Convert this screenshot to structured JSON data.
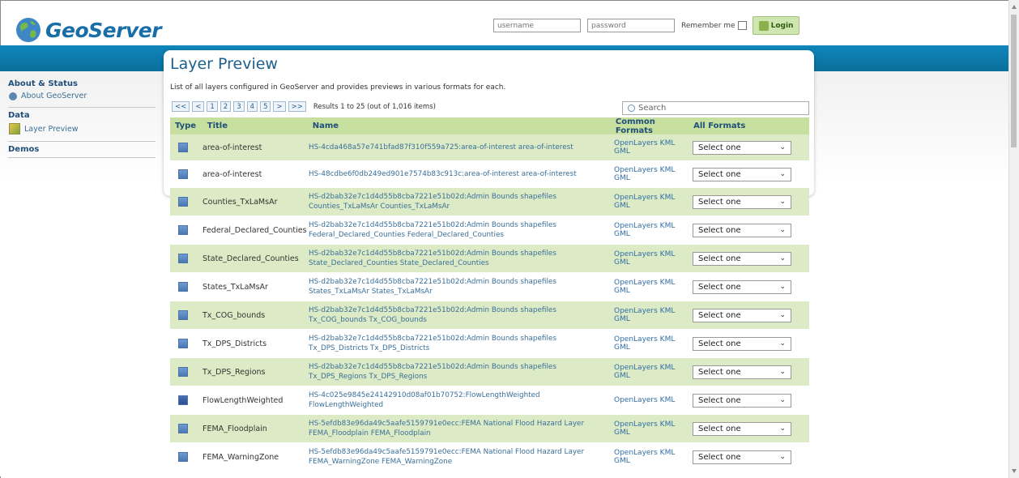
{
  "header": {
    "logo_text": "GeoServer",
    "username_placeholder": "username",
    "password_placeholder": "password",
    "remember_label": "Remember me",
    "login_label": "Login"
  },
  "sidebar": {
    "sections": [
      {
        "title": "About & Status",
        "items": [
          {
            "label": "About GeoServer",
            "icon": "info-icon"
          }
        ]
      },
      {
        "title": "Data",
        "items": [
          {
            "label": "Layer Preview",
            "icon": "layer-preview-icon"
          }
        ]
      },
      {
        "title": "Demos",
        "items": []
      }
    ]
  },
  "main": {
    "title": "Layer Preview",
    "description": "List of all layers configured in GeoServer and provides previews in various formats for each.",
    "pager": {
      "buttons": [
        "<<",
        "<",
        "1",
        "2",
        "3",
        "4",
        "5",
        ">",
        ">>"
      ],
      "results_text": "Results 1 to 25 (out of 1,016 items)"
    },
    "search_placeholder": "Search",
    "columns": {
      "type": "Type",
      "title": "Title",
      "name": "Name",
      "common": "Common Formats",
      "all": "All Formats"
    },
    "rows": [
      {
        "title": "area-of-interest",
        "name1": "HS-4cda468a57e741bfad87f310f559a725:area-of-interest area-of-interest",
        "name2": "",
        "common": "OpenLayers KML GML",
        "select": "Select one",
        "type": "polygon"
      },
      {
        "title": "area-of-interest",
        "name1": "HS-48cdbe6f0db249ed901e7574b83c913c:area-of-interest area-of-interest",
        "name2": "",
        "common": "OpenLayers KML GML",
        "select": "Select one",
        "type": "polygon"
      },
      {
        "title": "Counties_TxLaMsAr",
        "name1": "HS-d2bab32e7c1d4d55b8cba7221e51b02d:Admin Bounds shapefiles",
        "name2": "Counties_TxLaMsAr Counties_TxLaMsAr",
        "common": "OpenLayers KML GML",
        "select": "Select one",
        "type": "polygon"
      },
      {
        "title": "Federal_Declared_Counties",
        "name1": "HS-d2bab32e7c1d4d55b8cba7221e51b02d:Admin Bounds shapefiles",
        "name2": "Federal_Declared_Counties Federal_Declared_Counties",
        "common": "OpenLayers KML GML",
        "select": "Select one",
        "type": "polygon"
      },
      {
        "title": "State_Declared_Counties",
        "name1": "HS-d2bab32e7c1d4d55b8cba7221e51b02d:Admin Bounds shapefiles",
        "name2": "State_Declared_Counties State_Declared_Counties",
        "common": "OpenLayers KML GML",
        "select": "Select one",
        "type": "polygon"
      },
      {
        "title": "States_TxLaMsAr",
        "name1": "HS-d2bab32e7c1d4d55b8cba7221e51b02d:Admin Bounds shapefiles",
        "name2": "States_TxLaMsAr States_TxLaMsAr",
        "common": "OpenLayers KML GML",
        "select": "Select one",
        "type": "polygon"
      },
      {
        "title": "Tx_COG_bounds",
        "name1": "HS-d2bab32e7c1d4d55b8cba7221e51b02d:Admin Bounds shapefiles",
        "name2": "Tx_COG_bounds Tx_COG_bounds",
        "common": "OpenLayers KML GML",
        "select": "Select one",
        "type": "polygon"
      },
      {
        "title": "Tx_DPS_Districts",
        "name1": "HS-d2bab32e7c1d4d55b8cba7221e51b02d:Admin Bounds shapefiles",
        "name2": "Tx_DPS_Districts Tx_DPS_Districts",
        "common": "OpenLayers KML GML",
        "select": "Select one",
        "type": "polygon"
      },
      {
        "title": "Tx_DPS_Regions",
        "name1": "HS-d2bab32e7c1d4d55b8cba7221e51b02d:Admin Bounds shapefiles",
        "name2": "Tx_DPS_Regions Tx_DPS_Regions",
        "common": "OpenLayers KML GML",
        "select": "Select one",
        "type": "polygon"
      },
      {
        "title": "FlowLengthWeighted",
        "name1": "HS-4c025e9845e24142910d08af01b70752:FlowLengthWeighted",
        "name2": "FlowLengthWeighted",
        "common": "OpenLayers KML",
        "select": "Select one",
        "type": "raster"
      },
      {
        "title": "FEMA_Floodplain",
        "name1": "HS-5efdb83e96da49c5aafe5159791e0ecc:FEMA National Flood Hazard Layer",
        "name2": "FEMA_Floodplain FEMA_Floodplain",
        "common": "OpenLayers KML GML",
        "select": "Select one",
        "type": "polygon"
      },
      {
        "title": "FEMA_WarningZone",
        "name1": "HS-5efdb83e96da49c5aafe5159791e0ecc:FEMA National Flood Hazard Layer",
        "name2": "FEMA_WarningZone FEMA_WarningZone",
        "common": "OpenLayers KML GML",
        "select": "Select one",
        "type": "polygon"
      }
    ]
  }
}
